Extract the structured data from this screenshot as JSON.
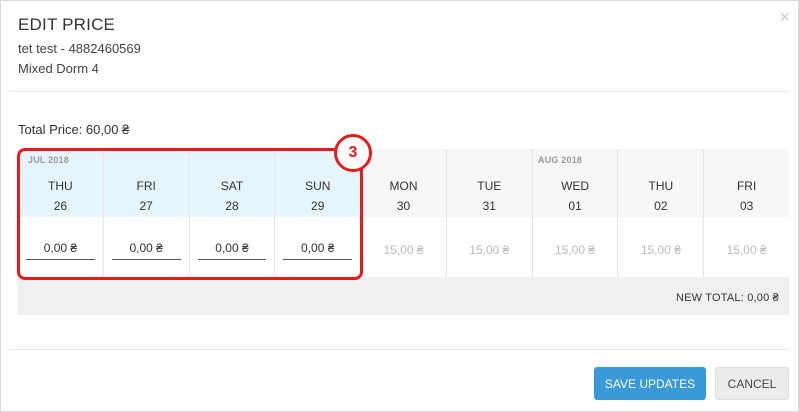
{
  "modal": {
    "title": "EDIT PRICE",
    "guest_line": "tet test - 4882460569",
    "room_line": "Mixed Dorm 4",
    "close_glyph": "×"
  },
  "total_price": "Total Price: 60,00 ₴",
  "calendar": {
    "months": [
      "JUL 2018",
      "AUG 2018"
    ],
    "days": [
      {
        "dow": "THU",
        "date": "26",
        "value": "0,00 ₴"
      },
      {
        "dow": "FRI",
        "date": "27",
        "value": "0,00 ₴"
      },
      {
        "dow": "SAT",
        "date": "28",
        "value": "0,00 ₴"
      },
      {
        "dow": "SUN",
        "date": "29",
        "value": "0,00 ₴"
      },
      {
        "dow": "MON",
        "date": "30",
        "placeholder": "15,00 ₴"
      },
      {
        "dow": "TUE",
        "date": "31",
        "placeholder": "15,00 ₴"
      },
      {
        "dow": "WED",
        "date": "01",
        "placeholder": "15,00 ₴"
      },
      {
        "dow": "THU",
        "date": "02",
        "placeholder": "15,00 ₴"
      },
      {
        "dow": "FRI",
        "date": "03",
        "placeholder": "15,00 ₴"
      }
    ],
    "new_total": "NEW TOTAL: 0,00 ₴"
  },
  "annotation": {
    "badge": "3",
    "color": "#e31d1d"
  },
  "buttons": {
    "save": "SAVE UPDATES",
    "cancel": "CANCEL"
  },
  "colors": {
    "accent": "#3a9ad9",
    "selected_bg": "#e6f4fc"
  }
}
